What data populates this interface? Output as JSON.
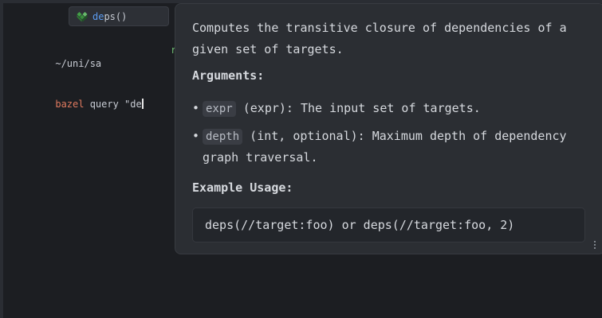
{
  "terminal": {
    "cwd": "~/uni/sa",
    "cwd_tail": "r",
    "command_bin": "bazel",
    "command_rest": " query \"de"
  },
  "completion": {
    "icon": "bazel-function-icon",
    "match": "de",
    "rest": "ps()"
  },
  "doc": {
    "description": "Computes the transitive closure of dependencies of a given set of targets.",
    "arguments_heading": "Arguments:",
    "args": [
      {
        "bullet": "•",
        "name": "expr",
        "text": " (expr): The input set of targets."
      },
      {
        "bullet": "•",
        "name": "depth",
        "text": " (int, optional): Maximum depth of dependency graph traversal."
      }
    ],
    "usage_heading": "Example Usage:",
    "usage_code": "deps(//target:foo) or deps(//target:foo, 2)"
  },
  "colors": {
    "background": "#1c1e22",
    "popup": "#2b2e33",
    "match_highlight": "#5b9bf0",
    "command_bin": "#e07a5f"
  }
}
